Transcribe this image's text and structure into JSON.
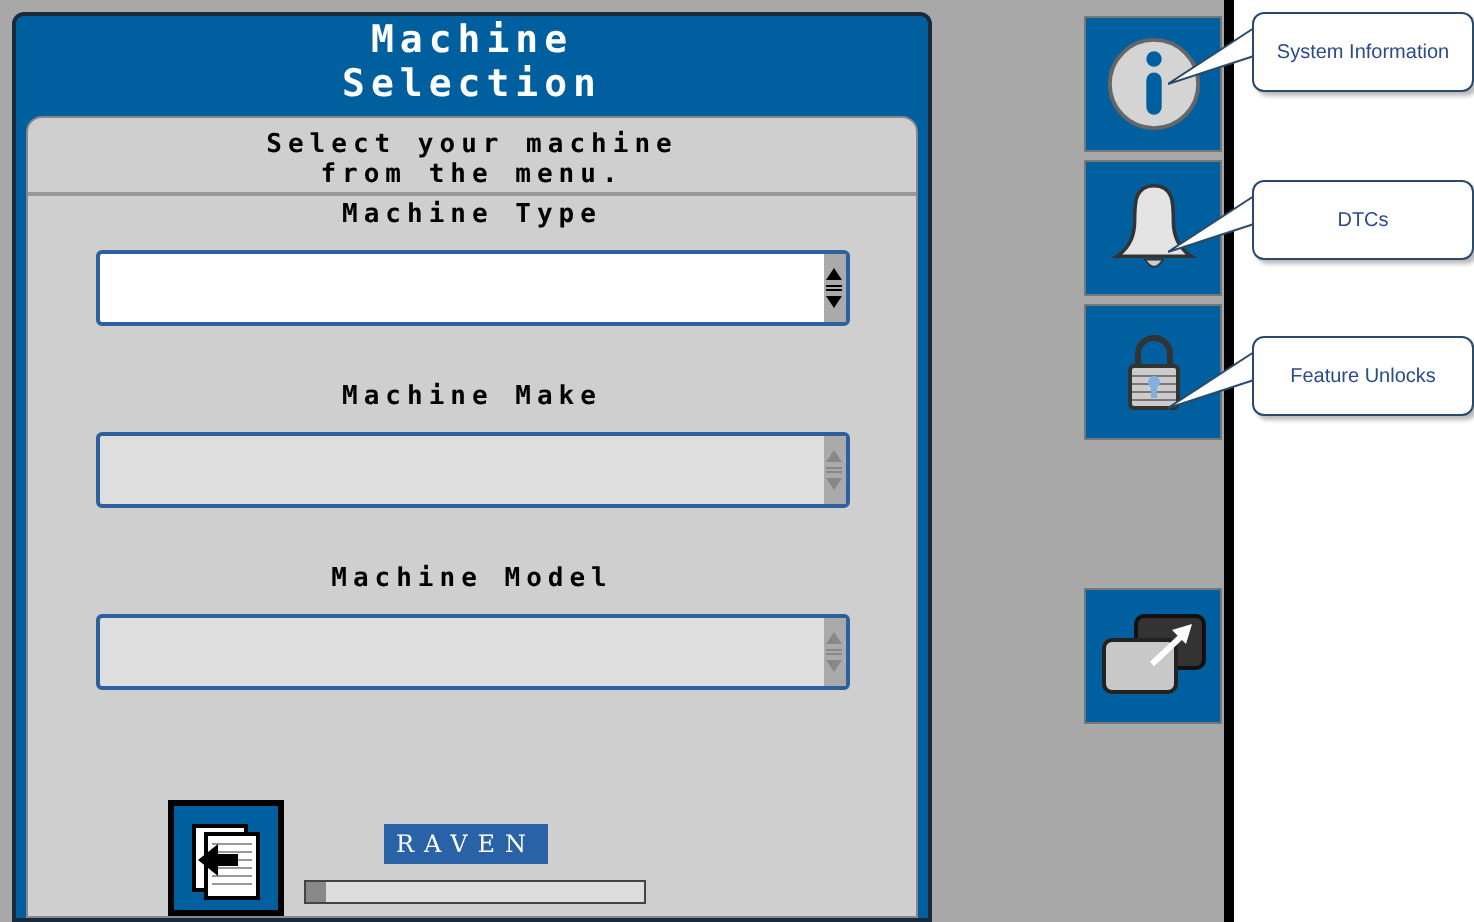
{
  "window": {
    "title_lines": [
      "Machine",
      "Selection"
    ]
  },
  "instruction_lines": [
    "Select your machine",
    "from the menu."
  ],
  "fields": [
    {
      "label": "Machine Type",
      "disabled": false
    },
    {
      "label": "Machine Make",
      "disabled": true
    },
    {
      "label": "Machine Model",
      "disabled": true
    }
  ],
  "logo": {
    "text": "RAVEN"
  },
  "progress": {
    "level": 0.06
  },
  "side_buttons": [
    {
      "kind": "info",
      "callout": "System Information"
    },
    {
      "kind": "bell",
      "callout": "DTCs"
    },
    {
      "kind": "lock",
      "callout": "Feature Unlocks"
    },
    {
      "kind": "switch"
    }
  ]
}
